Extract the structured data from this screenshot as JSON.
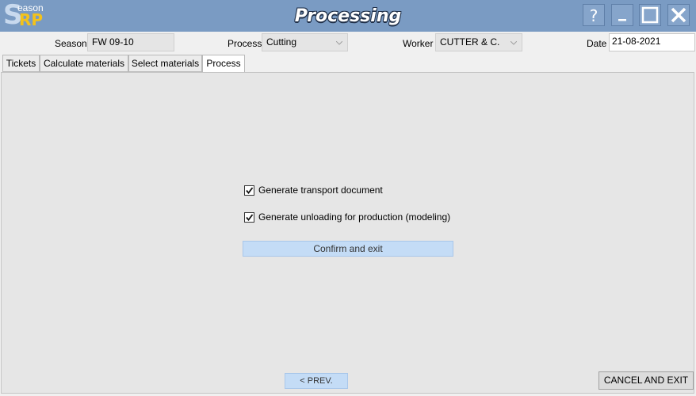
{
  "window": {
    "title": "Processing",
    "logo": {
      "first": "S",
      "rest": "eason",
      "suffix": "RP"
    }
  },
  "filters": {
    "season_label": "Season",
    "season_value": "FW 09-10",
    "process_label": "Process",
    "process_value": "Cutting",
    "worker_label": "Worker",
    "worker_value": "CUTTER & C.",
    "date_label": "Date",
    "date_value": "21-08-2021"
  },
  "tabs": [
    {
      "label": "Tickets",
      "active": false
    },
    {
      "label": "Calculate materials",
      "active": false
    },
    {
      "label": "Select materials",
      "active": false
    },
    {
      "label": "Process",
      "active": true
    }
  ],
  "process": {
    "option1": {
      "label": "Generate transport document",
      "checked": true
    },
    "option2": {
      "label": "Generate unloading for production (modeling)",
      "checked": true
    },
    "confirm_label": "Confirm and exit"
  },
  "footer": {
    "prev_label": "< PREV.",
    "cancel_label": "CANCEL AND EXIT"
  },
  "colors": {
    "titlebar": "#7a9bc3",
    "accent_button": "#c4dcf6",
    "logo_yellow": "#f3c21b"
  }
}
